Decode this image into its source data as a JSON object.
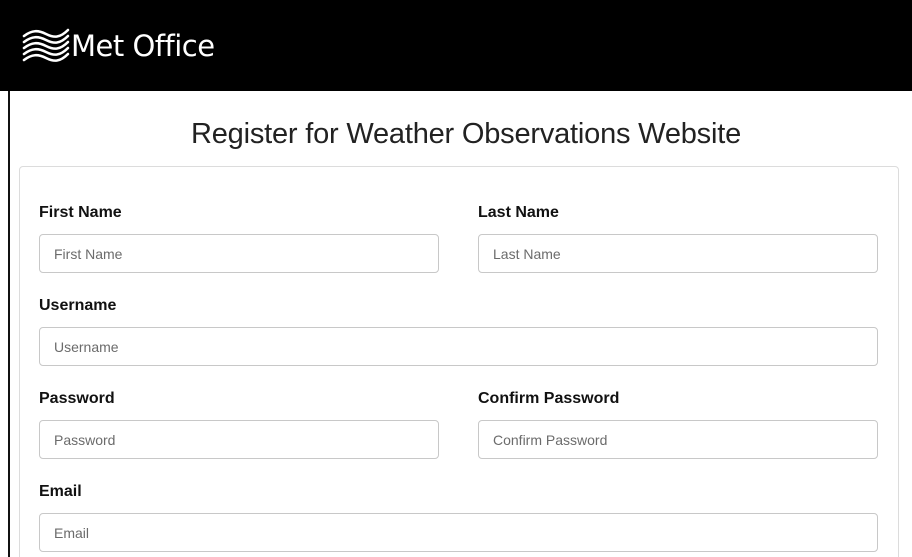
{
  "header": {
    "brand_name": "Met Office",
    "background_color": "#000000",
    "logo_icon": "met-office-waves-icon"
  },
  "main": {
    "title": "Register for Weather Observations Website"
  },
  "form": {
    "first_name": {
      "label": "First Name",
      "placeholder": "First Name",
      "value": ""
    },
    "last_name": {
      "label": "Last Name",
      "placeholder": "Last Name",
      "value": ""
    },
    "username": {
      "label": "Username",
      "placeholder": "Username",
      "value": ""
    },
    "password": {
      "label": "Password",
      "placeholder": "Password",
      "value": ""
    },
    "confirm_password": {
      "label": "Confirm Password",
      "placeholder": "Confirm Password",
      "value": ""
    },
    "email": {
      "label": "Email",
      "placeholder": "Email",
      "value": ""
    }
  }
}
